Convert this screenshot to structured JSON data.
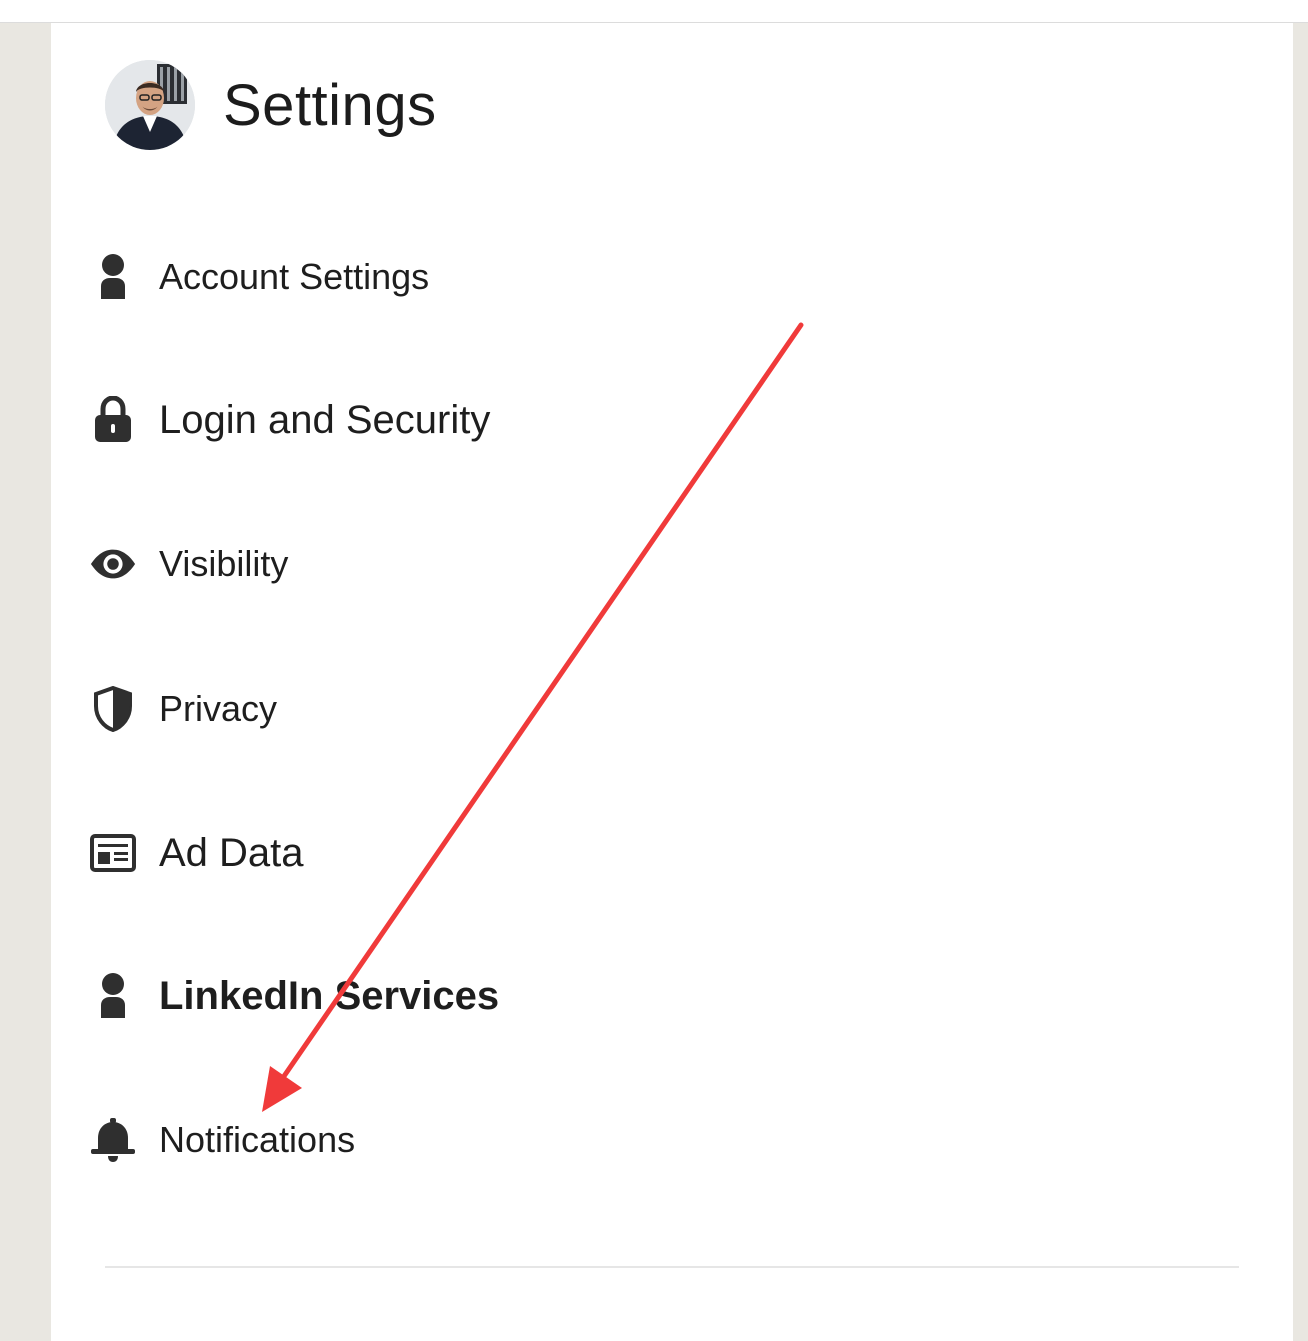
{
  "page": {
    "title": "Settings"
  },
  "menu": {
    "items": [
      {
        "label": "Account Settings",
        "icon": "person-icon"
      },
      {
        "label": "Login and Security",
        "icon": "lock-icon"
      },
      {
        "label": "Visibility",
        "icon": "eye-icon"
      },
      {
        "label": "Privacy",
        "icon": "shield-icon"
      },
      {
        "label": "Ad Data",
        "icon": "ad-data-icon"
      },
      {
        "label": "LinkedIn Services",
        "icon": "person-icon"
      },
      {
        "label": "Notifications",
        "icon": "bell-icon"
      }
    ]
  },
  "annotation": {
    "arrow_color": "#f03a3a",
    "points_to": "Notifications"
  }
}
